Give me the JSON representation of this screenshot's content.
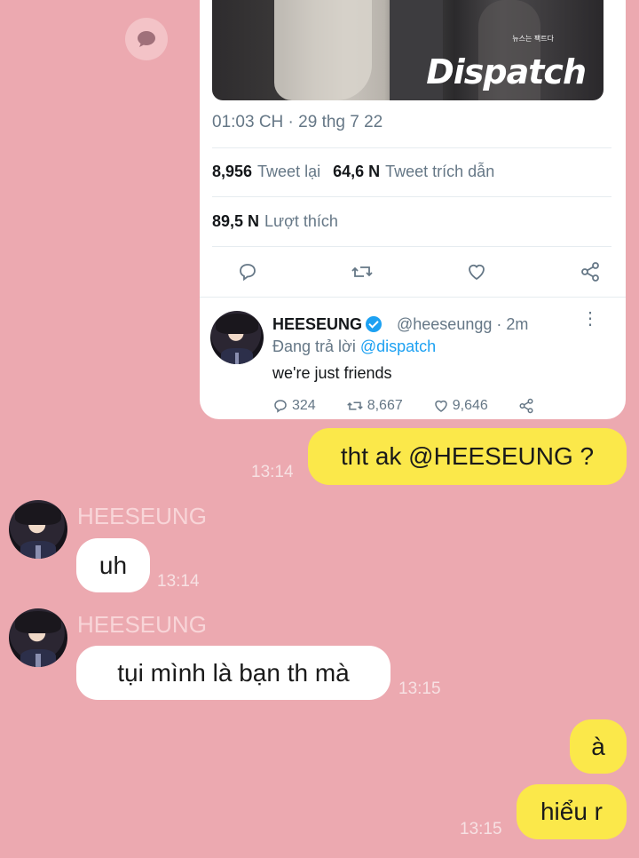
{
  "tweet": {
    "logo": "Dispatch",
    "logo_sub": "뉴스는 팩트다",
    "timestamp": "01:03 CH · 29 thg 7 22",
    "retweets_count": "8,956",
    "retweets_label": "Tweet lại",
    "quotes_count": "64,6 N",
    "quotes_label": "Tweet trích dẫn",
    "likes_count": "89,5 N",
    "likes_label": "Lượt thích",
    "actions": [
      "reply-icon",
      "retweet-icon",
      "like-icon",
      "share-icon"
    ]
  },
  "reply": {
    "name": "HEESEUNG",
    "handle": "@heeseungg · 2m",
    "replying_prefix": "Đang trả lời",
    "replying_mention": "@dispatch",
    "text": "we're just friends",
    "replies": "324",
    "retweets": "8,667",
    "likes": "9,646"
  },
  "messages": [
    {
      "from": "me",
      "text": "tht ak @HEESEUNG ?",
      "time": "13:14"
    },
    {
      "from": "HEESEUNG",
      "sender": "HEESEUNG",
      "text": "uh",
      "time": "13:14"
    },
    {
      "from": "HEESEUNG",
      "sender": "HEESEUNG",
      "text": "tụi mình là bạn th mà",
      "time": "13:15"
    },
    {
      "from": "me",
      "text": "à",
      "time": ""
    },
    {
      "from": "me",
      "text": "hiểu r",
      "time": "13:15"
    }
  ],
  "colors": {
    "background": "#eca9b0",
    "my_bubble": "#fbe84a",
    "their_bubble": "#ffffff",
    "twitter_blue": "#1da1f2"
  }
}
